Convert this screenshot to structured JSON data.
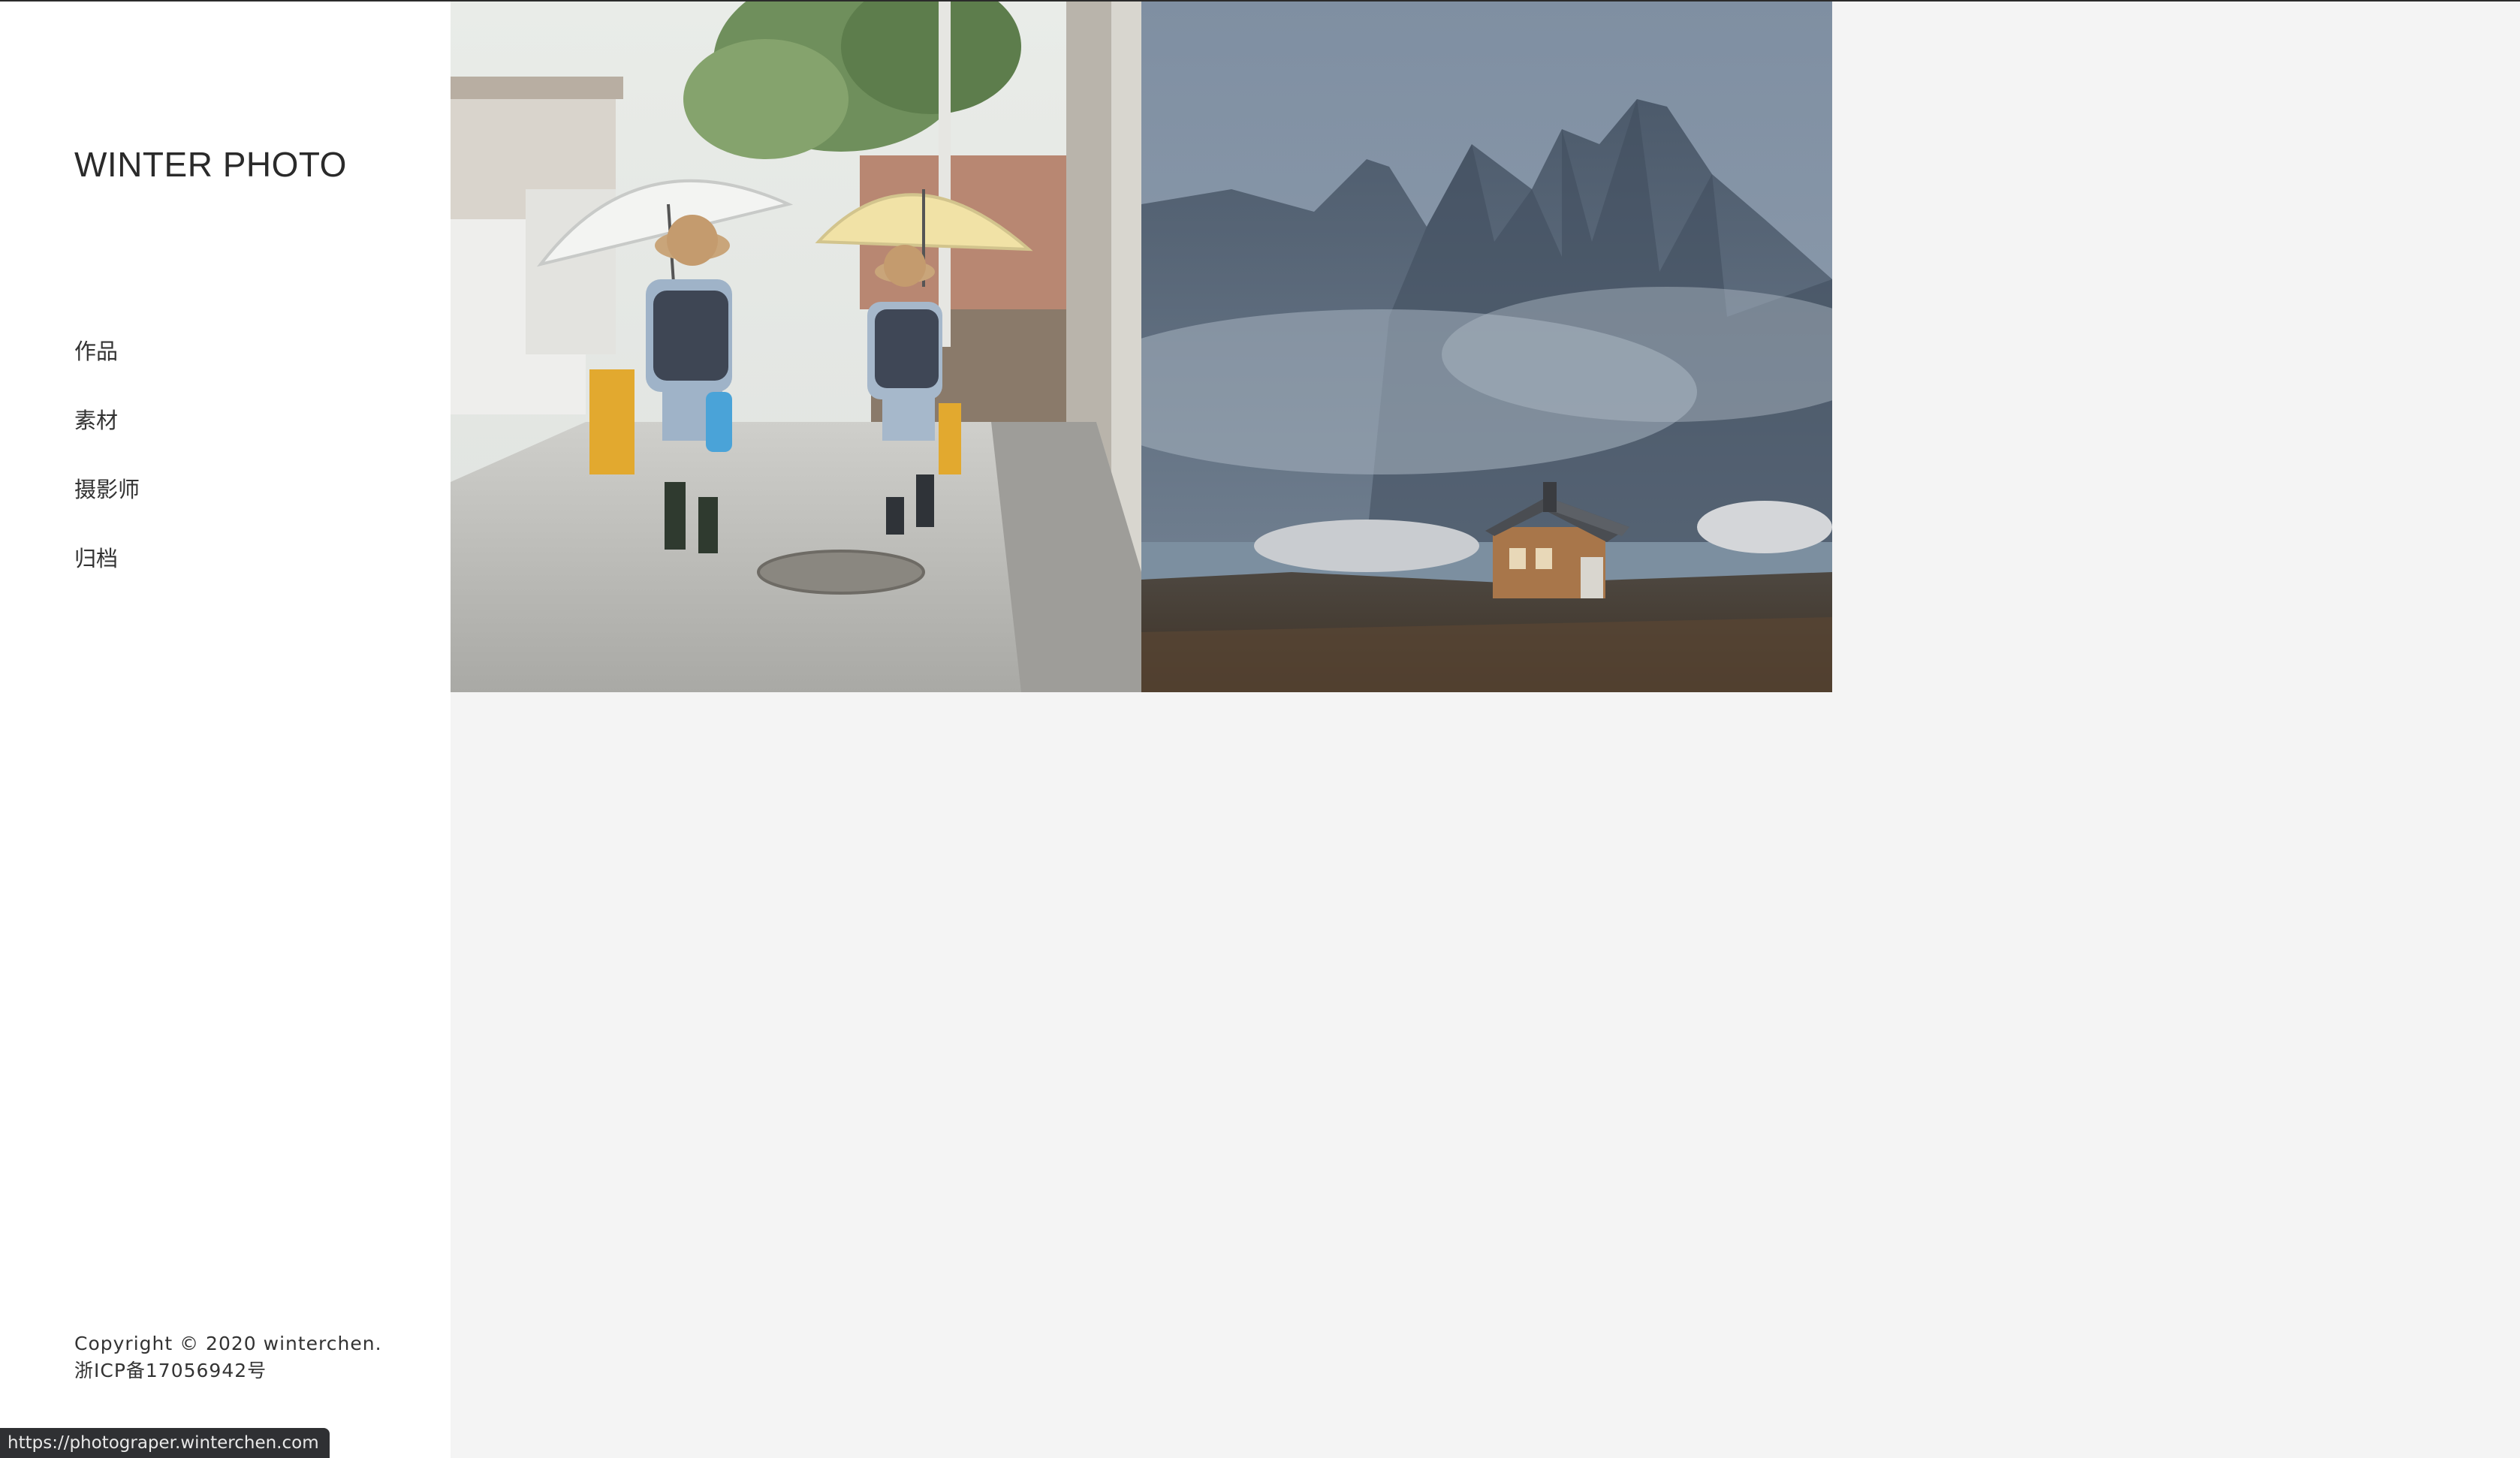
{
  "site": {
    "logo": "WINTER PHOTO"
  },
  "nav": {
    "items": [
      {
        "label": "作品"
      },
      {
        "label": "素材"
      },
      {
        "label": "摄影师"
      },
      {
        "label": "归档"
      }
    ]
  },
  "footer": {
    "copyright": "Copyright © 2020 winterchen.",
    "icp": "浙ICP备17056942号"
  },
  "gallery": {
    "photos": [
      {
        "icon": "photo-children-umbrellas"
      },
      {
        "icon": "photo-mountain-cabin"
      }
    ]
  },
  "statusbar": {
    "url": "https://photograper.winterchen.com"
  },
  "colors": {
    "sidebar_bg": "#ffffff",
    "content_bg": "#f4f4f4",
    "text": "#333333"
  }
}
